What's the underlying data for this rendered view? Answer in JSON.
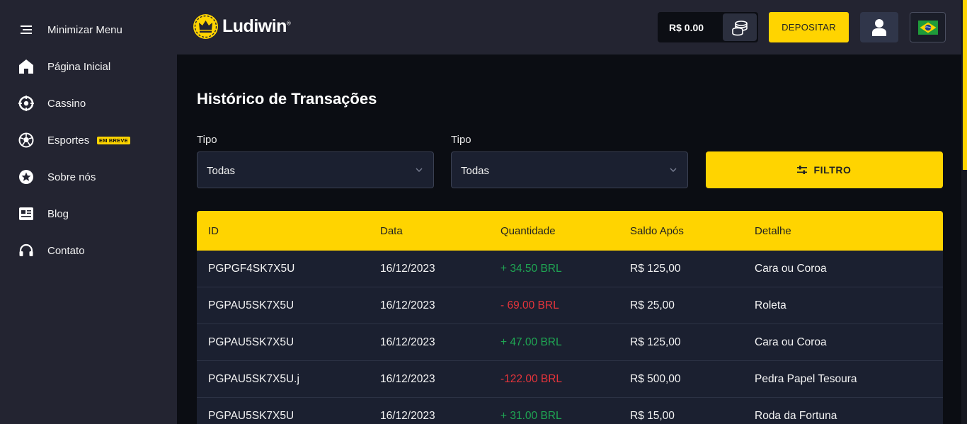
{
  "sidebar": {
    "items": [
      {
        "label": "Minimizar Menu",
        "icon": "menu-icon"
      },
      {
        "label": "Página Inicial",
        "icon": "home-icon"
      },
      {
        "label": "Cassino",
        "icon": "casino-chip-icon"
      },
      {
        "label": "Esportes",
        "icon": "soccer-ball-icon",
        "badge": "EM BREVE"
      },
      {
        "label": "Sobre nós",
        "icon": "star-icon"
      },
      {
        "label": "Blog",
        "icon": "newspaper-icon"
      },
      {
        "label": "Contato",
        "icon": "headset-icon"
      }
    ]
  },
  "header": {
    "logo_text": "Ludiwin",
    "logo_mark": "®",
    "balance": "R$ 0.00",
    "deposit_label": "DEPOSITAR"
  },
  "main": {
    "title": "Histórico de Transações",
    "filters": [
      {
        "label": "Tipo",
        "value": "Todas"
      },
      {
        "label": "Tipo",
        "value": "Todas"
      }
    ],
    "filter_button": "FILTRO"
  },
  "table": {
    "columns": [
      "ID",
      "Data",
      "Quantidade",
      "Saldo Após",
      "Detalhe"
    ],
    "rows": [
      {
        "id": "PGPGF4SK7X5U",
        "date": "16/12/2023",
        "amount": "+ 34.50 BRL",
        "sign": "positive",
        "balance": "R$ 125,00",
        "detail": "Cara ou Coroa"
      },
      {
        "id": "PGPAU5SK7X5U",
        "date": "16/12/2023",
        "amount": "- 69.00 BRL",
        "sign": "negative",
        "balance": "R$ 25,00",
        "detail": "Roleta"
      },
      {
        "id": "PGPAU5SK7X5U",
        "date": "16/12/2023",
        "amount": "+ 47.00 BRL",
        "sign": "positive",
        "balance": "R$ 125,00",
        "detail": "Cara ou Coroa"
      },
      {
        "id": "PGPAU5SK7X5U.j",
        "date": "16/12/2023",
        "amount": "-122.00 BRL",
        "sign": "negative",
        "balance": "R$ 500,00",
        "detail": "Pedra Papel Tesoura"
      },
      {
        "id": "PGPAU5SK7X5U",
        "date": "16/12/2023",
        "amount": "+ 31.00 BRL",
        "sign": "positive",
        "balance": "R$ 15,00",
        "detail": "Roda da Fortuna"
      }
    ]
  },
  "colors": {
    "accent": "#ffd400",
    "sidebar_bg": "#232431",
    "page_bg": "#0b0d13",
    "positive": "#1fa653",
    "negative": "#e5343b"
  }
}
